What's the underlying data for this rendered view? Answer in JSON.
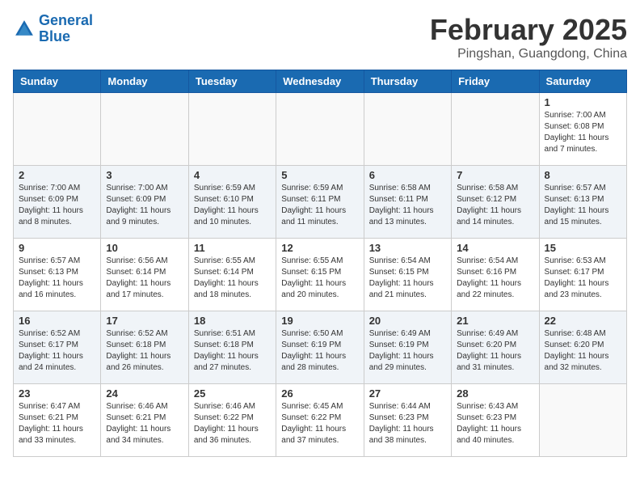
{
  "header": {
    "logo_line1": "General",
    "logo_line2": "Blue",
    "main_title": "February 2025",
    "subtitle": "Pingshan, Guangdong, China"
  },
  "calendar": {
    "days_of_week": [
      "Sunday",
      "Monday",
      "Tuesday",
      "Wednesday",
      "Thursday",
      "Friday",
      "Saturday"
    ],
    "weeks": [
      [
        {
          "day": "",
          "info": ""
        },
        {
          "day": "",
          "info": ""
        },
        {
          "day": "",
          "info": ""
        },
        {
          "day": "",
          "info": ""
        },
        {
          "day": "",
          "info": ""
        },
        {
          "day": "",
          "info": ""
        },
        {
          "day": "1",
          "info": "Sunrise: 7:00 AM\nSunset: 6:08 PM\nDaylight: 11 hours\nand 7 minutes."
        }
      ],
      [
        {
          "day": "2",
          "info": "Sunrise: 7:00 AM\nSunset: 6:09 PM\nDaylight: 11 hours\nand 8 minutes."
        },
        {
          "day": "3",
          "info": "Sunrise: 7:00 AM\nSunset: 6:09 PM\nDaylight: 11 hours\nand 9 minutes."
        },
        {
          "day": "4",
          "info": "Sunrise: 6:59 AM\nSunset: 6:10 PM\nDaylight: 11 hours\nand 10 minutes."
        },
        {
          "day": "5",
          "info": "Sunrise: 6:59 AM\nSunset: 6:11 PM\nDaylight: 11 hours\nand 11 minutes."
        },
        {
          "day": "6",
          "info": "Sunrise: 6:58 AM\nSunset: 6:11 PM\nDaylight: 11 hours\nand 13 minutes."
        },
        {
          "day": "7",
          "info": "Sunrise: 6:58 AM\nSunset: 6:12 PM\nDaylight: 11 hours\nand 14 minutes."
        },
        {
          "day": "8",
          "info": "Sunrise: 6:57 AM\nSunset: 6:13 PM\nDaylight: 11 hours\nand 15 minutes."
        }
      ],
      [
        {
          "day": "9",
          "info": "Sunrise: 6:57 AM\nSunset: 6:13 PM\nDaylight: 11 hours\nand 16 minutes."
        },
        {
          "day": "10",
          "info": "Sunrise: 6:56 AM\nSunset: 6:14 PM\nDaylight: 11 hours\nand 17 minutes."
        },
        {
          "day": "11",
          "info": "Sunrise: 6:55 AM\nSunset: 6:14 PM\nDaylight: 11 hours\nand 18 minutes."
        },
        {
          "day": "12",
          "info": "Sunrise: 6:55 AM\nSunset: 6:15 PM\nDaylight: 11 hours\nand 20 minutes."
        },
        {
          "day": "13",
          "info": "Sunrise: 6:54 AM\nSunset: 6:15 PM\nDaylight: 11 hours\nand 21 minutes."
        },
        {
          "day": "14",
          "info": "Sunrise: 6:54 AM\nSunset: 6:16 PM\nDaylight: 11 hours\nand 22 minutes."
        },
        {
          "day": "15",
          "info": "Sunrise: 6:53 AM\nSunset: 6:17 PM\nDaylight: 11 hours\nand 23 minutes."
        }
      ],
      [
        {
          "day": "16",
          "info": "Sunrise: 6:52 AM\nSunset: 6:17 PM\nDaylight: 11 hours\nand 24 minutes."
        },
        {
          "day": "17",
          "info": "Sunrise: 6:52 AM\nSunset: 6:18 PM\nDaylight: 11 hours\nand 26 minutes."
        },
        {
          "day": "18",
          "info": "Sunrise: 6:51 AM\nSunset: 6:18 PM\nDaylight: 11 hours\nand 27 minutes."
        },
        {
          "day": "19",
          "info": "Sunrise: 6:50 AM\nSunset: 6:19 PM\nDaylight: 11 hours\nand 28 minutes."
        },
        {
          "day": "20",
          "info": "Sunrise: 6:49 AM\nSunset: 6:19 PM\nDaylight: 11 hours\nand 29 minutes."
        },
        {
          "day": "21",
          "info": "Sunrise: 6:49 AM\nSunset: 6:20 PM\nDaylight: 11 hours\nand 31 minutes."
        },
        {
          "day": "22",
          "info": "Sunrise: 6:48 AM\nSunset: 6:20 PM\nDaylight: 11 hours\nand 32 minutes."
        }
      ],
      [
        {
          "day": "23",
          "info": "Sunrise: 6:47 AM\nSunset: 6:21 PM\nDaylight: 11 hours\nand 33 minutes."
        },
        {
          "day": "24",
          "info": "Sunrise: 6:46 AM\nSunset: 6:21 PM\nDaylight: 11 hours\nand 34 minutes."
        },
        {
          "day": "25",
          "info": "Sunrise: 6:46 AM\nSunset: 6:22 PM\nDaylight: 11 hours\nand 36 minutes."
        },
        {
          "day": "26",
          "info": "Sunrise: 6:45 AM\nSunset: 6:22 PM\nDaylight: 11 hours\nand 37 minutes."
        },
        {
          "day": "27",
          "info": "Sunrise: 6:44 AM\nSunset: 6:23 PM\nDaylight: 11 hours\nand 38 minutes."
        },
        {
          "day": "28",
          "info": "Sunrise: 6:43 AM\nSunset: 6:23 PM\nDaylight: 11 hours\nand 40 minutes."
        },
        {
          "day": "",
          "info": ""
        }
      ]
    ]
  }
}
